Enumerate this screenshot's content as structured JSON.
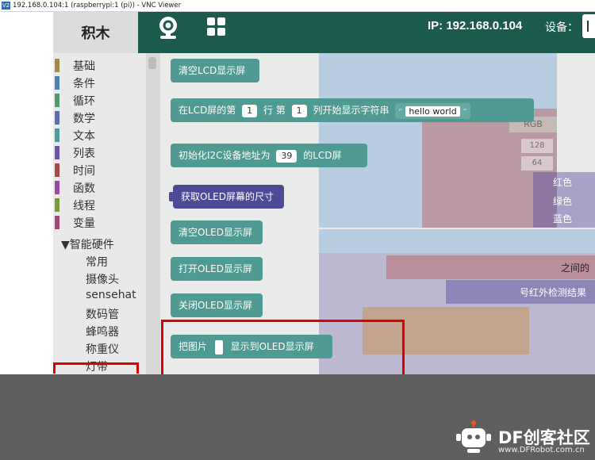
{
  "window": {
    "title": "192.168.0.104:1 (raspberrypi:1 (pi)) - VNC Viewer",
    "app_icon_text": "V2"
  },
  "header": {
    "logo_text": "积木",
    "ip_text": "IP: 192.168.0.104",
    "device_label": "设备：",
    "camera_icon": "webcam-icon",
    "grid_icon": "apps-grid-icon"
  },
  "categories": [
    {
      "label": "基础",
      "color": "#a08b4a"
    },
    {
      "label": "条件",
      "color": "#4e80b3"
    },
    {
      "label": "循环",
      "color": "#4e9a6e"
    },
    {
      "label": "数学",
      "color": "#5a6ea8"
    },
    {
      "label": "文本",
      "color": "#4f9aa0"
    },
    {
      "label": "列表",
      "color": "#6c55a8"
    },
    {
      "label": "时间",
      "color": "#a84a4a"
    },
    {
      "label": "函数",
      "color": "#9a4aa0"
    },
    {
      "label": "线程",
      "color": "#7a9a3a"
    },
    {
      "label": "变量",
      "color": "#a04a7a"
    }
  ],
  "hardware": {
    "label": "▼智能硬件",
    "items": [
      "常用",
      "摄像头",
      "sensehat",
      "数码管",
      "蜂鸣器",
      "称重仪",
      "灯带"
    ]
  },
  "blocks": {
    "clear_lcd": "清空LCD显示屏",
    "lcd_show": {
      "prefix": "在LCD屏的第",
      "row": "1",
      "mid": "行 第",
      "col": "1",
      "suffix": "列开始显示字符串",
      "quote_open": "“",
      "text": "hello world",
      "quote_close": "”"
    },
    "init_i2c": {
      "prefix": "初始化I2C设备地址为",
      "addr": "39",
      "suffix": "的LCD屏"
    },
    "get_oled_size": "获取OLED屏幕的尺寸",
    "clear_oled": "清空OLED显示屏",
    "open_oled": "打开OLED显示屏",
    "close_oled": "关闭OLED显示屏",
    "show_image": {
      "prefix": "把图片",
      "suffix": "显示到OLED显示屏"
    }
  },
  "background_blocks": {
    "rgb": "RGB",
    "val_128": "128",
    "val_64": "64",
    "color_red": "红色",
    "color_green": "绿色",
    "color_blue": "蓝色",
    "between": "之间的",
    "detect": "号红外检测结果"
  },
  "footer": {
    "brand": "DF创客社区",
    "url": "www.DFRobot.com.cn",
    "icon": "robot-mascot-icon"
  }
}
